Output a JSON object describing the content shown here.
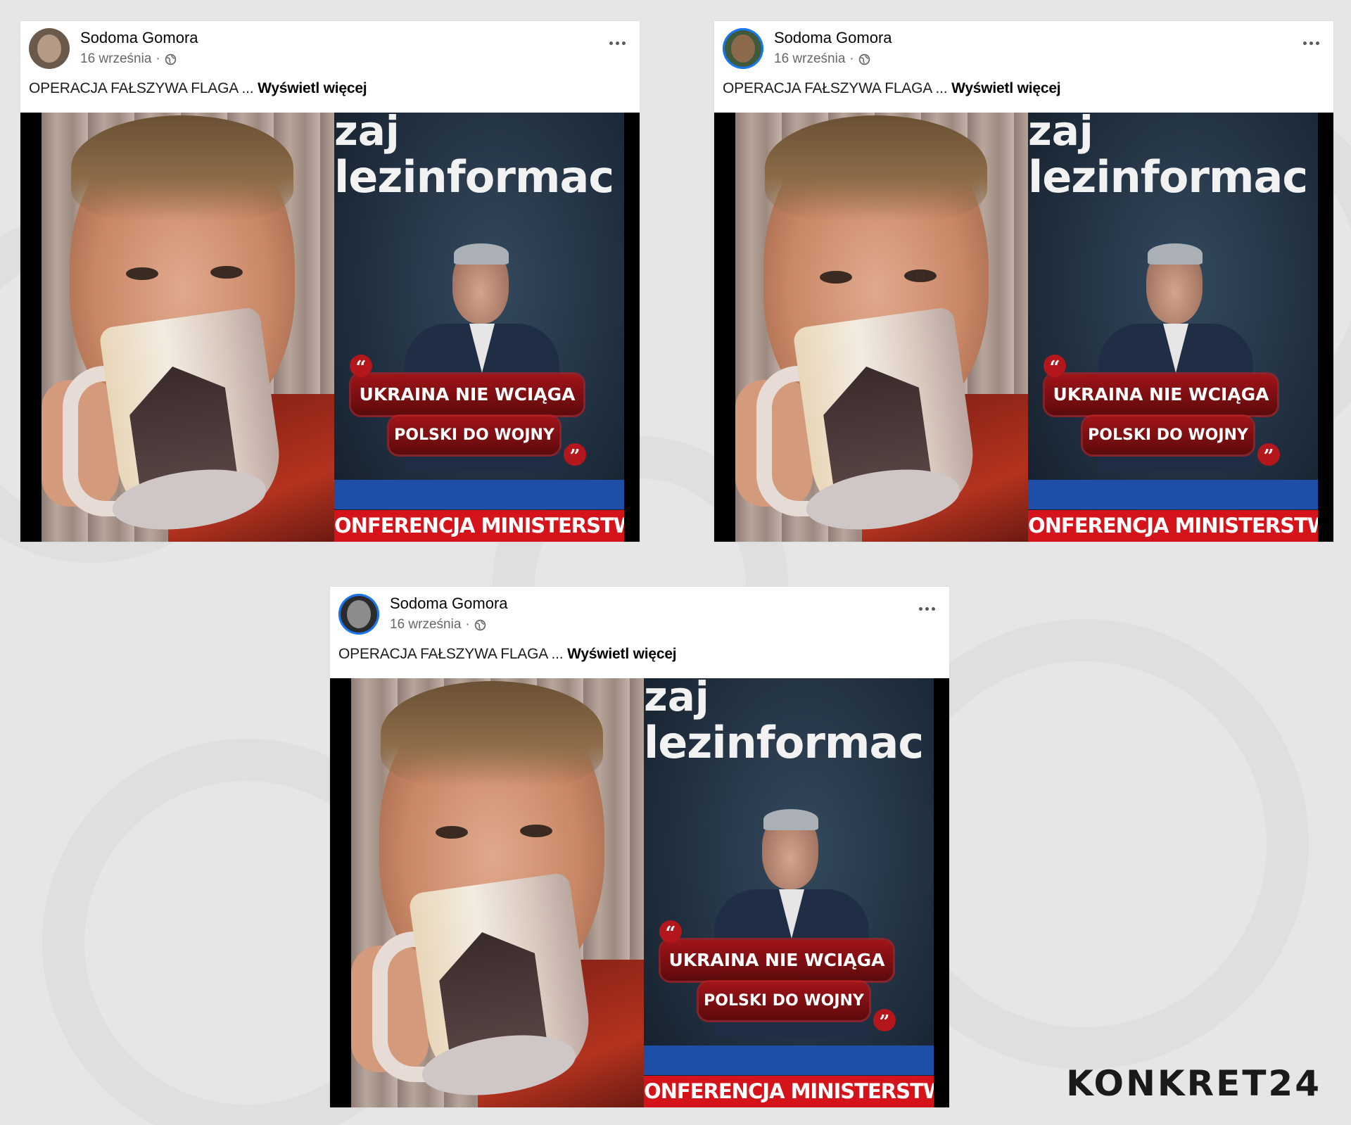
{
  "posts": [
    {
      "author": "Sodoma Gomora",
      "date": "16 września",
      "separator": "·",
      "text": "OPERACJA FAŁSZYWA FLAGA ...",
      "see_more": "Wyświetl więcej",
      "video": {
        "top_text": "zaj",
        "headline": "lezinformac",
        "caption_line1": "UKRAINA NIE WCIĄGA",
        "caption_line2": "POLSKI DO WOJNY",
        "quote_open": "“",
        "quote_close": "”",
        "bottom_bar": "ONFERENCJA MINISTERSTWA"
      }
    },
    {
      "author": "Sodoma Gomora",
      "date": "16 września",
      "separator": "·",
      "text": "OPERACJA FAŁSZYWA FLAGA ...",
      "see_more": "Wyświetl więcej",
      "video": {
        "top_text": "zaj",
        "headline": "lezinformac",
        "caption_line1": "UKRAINA NIE WCIĄGA",
        "caption_line2": "POLSKI DO WOJNY",
        "quote_open": "“",
        "quote_close": "”",
        "bottom_bar": "ONFERENCJA MINISTERSTWA"
      }
    },
    {
      "author": "Sodoma Gomora",
      "date": "16 września",
      "separator": "·",
      "text": "OPERACJA FAŁSZYWA FLAGA ...",
      "see_more": "Wyświetl więcej",
      "video": {
        "top_text": "zaj",
        "headline": "lezinformac",
        "caption_line1": "UKRAINA NIE WCIĄGA",
        "caption_line2": "POLSKI DO WOJNY",
        "quote_open": "“",
        "quote_close": "”",
        "bottom_bar": "ONFERENCJA MINISTERSTWA"
      }
    }
  ],
  "icons": {
    "globe": "globe-icon",
    "more": "more-options-icon"
  },
  "colors": {
    "accent_ring": "#1877f2",
    "caption_red": "#b3161b",
    "bar_red": "#d4141a"
  },
  "brand": "KONKRET24"
}
